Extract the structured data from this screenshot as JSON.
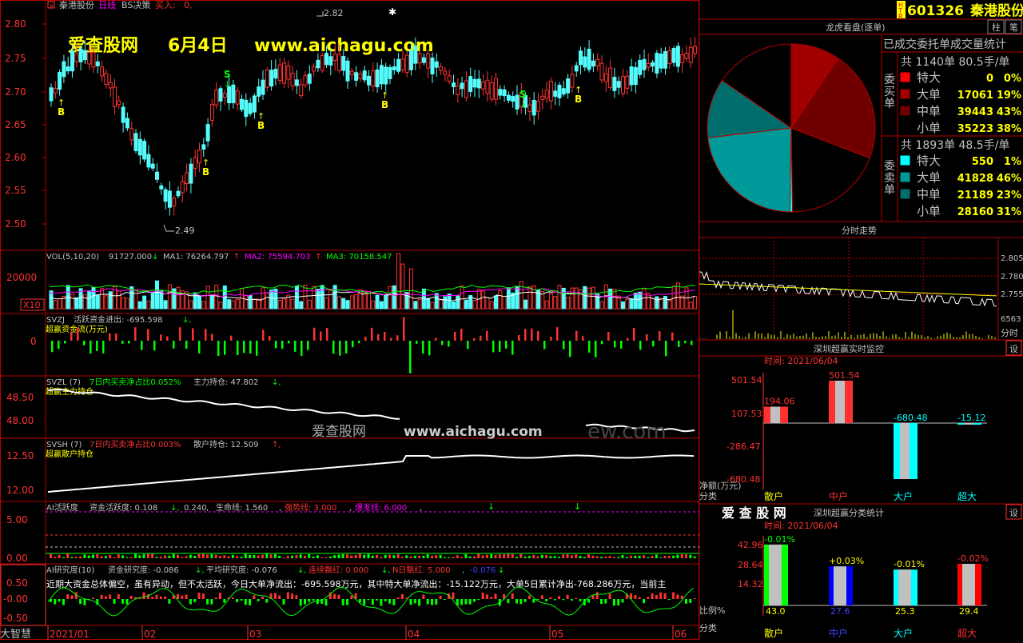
{
  "colors": {
    "bg": "#000000",
    "up": "#ff3232",
    "down": "#54fcfc",
    "grid": "#b40000",
    "axis": "#ff0000",
    "yellow": "#ffff00",
    "white": "#ffffff",
    "magenta": "#ff00ff",
    "green": "#00ff00",
    "label": "#c0c0c0"
  },
  "header": {
    "stock_name": "秦港股份",
    "period": "日线",
    "strategy": "BS决策",
    "buy_label": "买入:",
    "buy_value": "0,",
    "close_icon": "close-icon"
  },
  "watermark": {
    "site": "爱查股网",
    "date": "6月4日",
    "url": "www.aichagu.com",
    "mid_site": "爱查股网",
    "mid_url": "www.aichagu.com",
    "mid_fragment": "ew.com"
  },
  "kline": {
    "y_ticks": [
      "2.80",
      "2.75",
      "2.70",
      "2.65",
      "2.60",
      "2.55",
      "2.50"
    ],
    "high_label": "2.82",
    "low_label": "2.49",
    "buy_marker": "B",
    "sell_marker": "S"
  },
  "vol": {
    "name": "VOL(5,10,20)",
    "value": "91727.000",
    "ma1": "MA1: 76264.797",
    "ma2": "MA2: 75594.703",
    "ma3": "MA3: 70158.547",
    "tick": "20000",
    "unit": "X10"
  },
  "svzj": {
    "name": "SVZJ",
    "desc": "活跃资金进出: -695.598",
    "sub": "超赢资金流(万元)",
    "tick": "0"
  },
  "svzl": {
    "name": "SVZL (7)",
    "desc": "7日内买卖净占比0.052%",
    "hold": "主力持仓: 47.802",
    "sub": "超赢主力持仓",
    "ticks": [
      "48.50",
      "48.00"
    ]
  },
  "svsh": {
    "name": "SVSH (7)",
    "desc": "7日内买卖净占比0.003%",
    "hold": "散户持仓: 12.509",
    "sub": "超赢散户持仓",
    "ticks": [
      "12.50",
      "12.00"
    ]
  },
  "ai1": {
    "name": "AI活跃度",
    "a": "资金活跃度: 0.108",
    "b": "0.240",
    "c": "生命线: 1.560",
    "d": "强势线: 3.000",
    "e": "爆发线: 6.000",
    "ticks": [
      "5.00",
      "0.00"
    ]
  },
  "ai2": {
    "name": "AI研究度(10)",
    "a": "资金研究度: -0.086",
    "b": "平均研究度: -0.076",
    "c": "连续飘红: 0.000",
    "d": "N日飘红: 5.000",
    "e": "-0.076",
    "ticks": [
      "0.50",
      "-0.00",
      "-0.50"
    ],
    "comment": "近期大资金总体偏空，虽有异动，但不太活跃，今日大单净流出：-695.598万元，其中特大单净流出：-15.122万元，大单5日累计净出-768.286万元，当前主"
  },
  "xaxis": {
    "corner": "大智慧",
    "labels": [
      "2021/01",
      "02",
      "03",
      "04",
      "05",
      "06"
    ]
  },
  "side": {
    "code": "601326",
    "name": "秦港股份",
    "htr": [
      "H",
      "T",
      "R"
    ],
    "btn_zhu": "柱",
    "btn_bi": "笔",
    "lhkp_title": "龙虎看盘(逐单)",
    "stats_title": "已成交委托单成交量统计",
    "buy": {
      "side_label": "委买单",
      "total": "共 1140单 80.5手/单",
      "rows": [
        {
          "label": "特大",
          "count": "0",
          "pct": "0%",
          "color": "#ff0000"
        },
        {
          "label": "大单",
          "count": "17061",
          "pct": "19%",
          "color": "#a00000"
        },
        {
          "label": "中单",
          "count": "39443",
          "pct": "43%",
          "color": "#700000"
        },
        {
          "label": "小单",
          "count": "35223",
          "pct": "38%",
          "color": "#000000"
        }
      ]
    },
    "sell": {
      "side_label": "委卖单",
      "total": "共 1893单 48.5手/单",
      "rows": [
        {
          "label": "特大",
          "count": "550",
          "pct": "1%",
          "color": "#00ffff"
        },
        {
          "label": "大单",
          "count": "41828",
          "pct": "46%",
          "color": "#009999"
        },
        {
          "label": "中单",
          "count": "21189",
          "pct": "23%",
          "color": "#006d6d"
        },
        {
          "label": "小单",
          "count": "28160",
          "pct": "31%",
          "color": "#000000"
        }
      ]
    },
    "fenshi": {
      "title": "分时走势",
      "ticks": [
        "2.805",
        "2.780",
        "2.755"
      ],
      "vol_tick": "6563",
      "label": "分时"
    },
    "monitor1": {
      "title": "深圳超赢实时监控",
      "btn": "设",
      "time": "时间: 2021/06/04",
      "y_ticks": [
        "501.54",
        "107.53",
        "-286.47",
        "-680.48"
      ],
      "ylabel": "净额(万元)",
      "xlabel": "分类",
      "cats": [
        "散户",
        "中户",
        "大户",
        "超大"
      ],
      "values": [
        194.06,
        501.54,
        -680.48,
        -15.12
      ],
      "value_labels": [
        "194.06",
        "501.54",
        "-680.48",
        "-15.12"
      ]
    },
    "monitor2": {
      "logo": "爱 查 股 网",
      "title": "深圳超赢分类统计",
      "btn": "设",
      "time": "时间: 2021/06/04",
      "y_ticks": [
        "42.96",
        "28.64",
        "14.32"
      ],
      "ylabel": "比例%",
      "xlabel": "分类",
      "cats": [
        "散户",
        "中户",
        "大户",
        "超大"
      ],
      "values": [
        43.0,
        27.6,
        25.3,
        29.4
      ],
      "value_labels": [
        "43.0",
        "27.6",
        "25.3",
        "29.4"
      ],
      "changes": [
        "-0.01%",
        "+0.03%",
        "-0.01%",
        "-0.02%"
      ]
    }
  }
}
